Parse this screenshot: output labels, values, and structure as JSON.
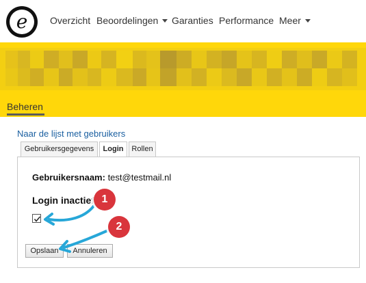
{
  "nav": {
    "logo_letter": "e",
    "items": [
      {
        "label": "Overzicht",
        "dropdown": false
      },
      {
        "label": "Beoordelingen",
        "dropdown": true
      },
      {
        "label": "Garanties",
        "dropdown": false
      },
      {
        "label": "Performance",
        "dropdown": false
      },
      {
        "label": "Meer",
        "dropdown": true
      }
    ]
  },
  "banner": {
    "manage_tab": "Beheren",
    "color": "#ffd70a"
  },
  "back_link": "Naar de lijst met gebruikers",
  "tabs": [
    {
      "label": "Gebruikersgegevens",
      "active": false
    },
    {
      "label": "Login",
      "active": true
    },
    {
      "label": "Rollen",
      "active": false
    }
  ],
  "form": {
    "username_label": "Gebruikersnaam:",
    "username_value": "test@testmail.nl",
    "section_heading": "Login inactief",
    "checkbox_checked": true,
    "save_label": "Opslaan",
    "cancel_label": "Annuleren"
  },
  "annotations": {
    "badge1": "1",
    "badge2": "2",
    "badge_color": "#d9353c",
    "arrow_color": "#27a7d8"
  }
}
